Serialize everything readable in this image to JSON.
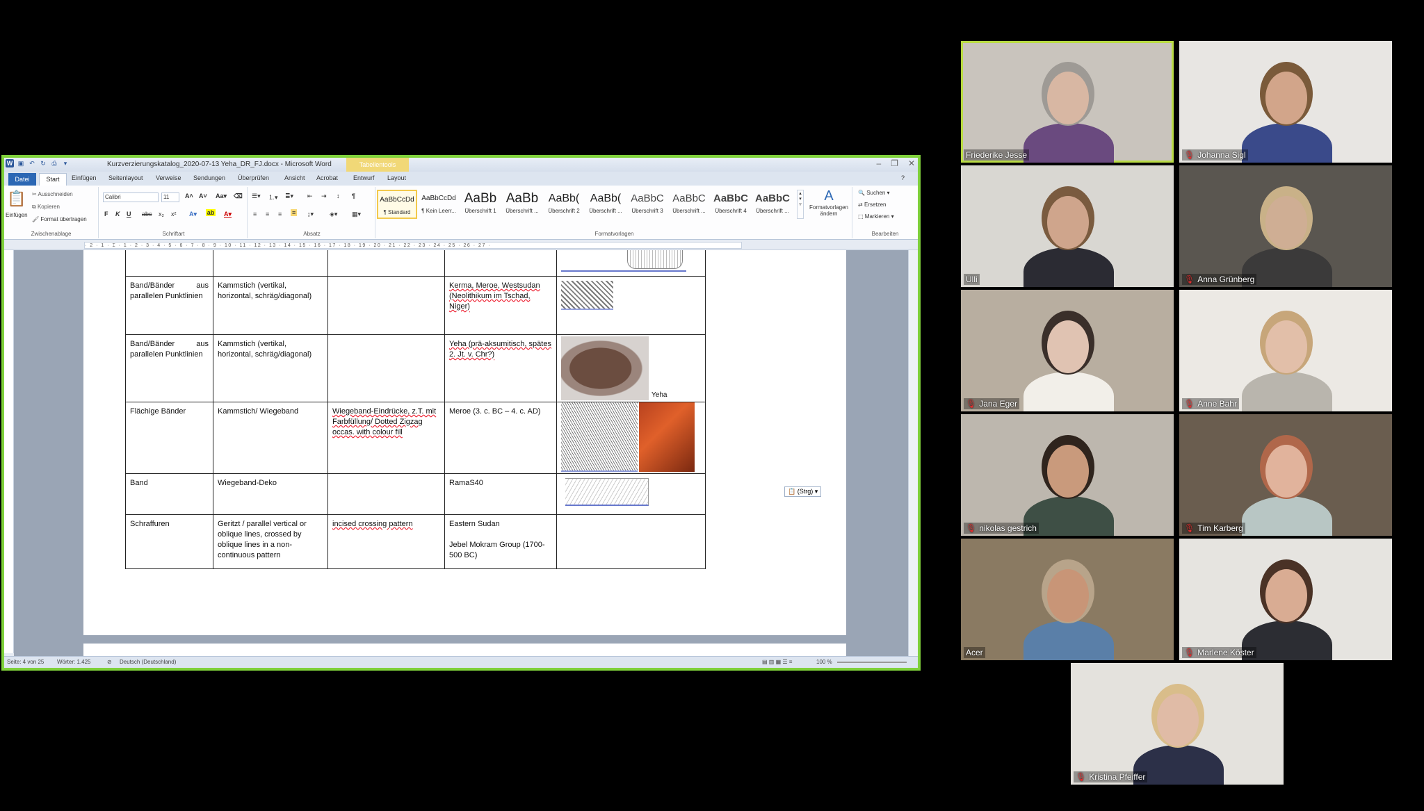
{
  "window": {
    "title": "Kurzverzierungskatalog_2020-07-13 Yeha_DR_FJ.docx - Microsoft Word",
    "context_tab": "Tabellentools",
    "controls": [
      "–",
      "❐",
      "✕"
    ]
  },
  "ribbon_tabs": [
    "Datei",
    "Start",
    "Einfügen",
    "Seitenlayout",
    "Verweise",
    "Sendungen",
    "Überprüfen",
    "Ansicht",
    "Acrobat",
    "Entwurf",
    "Layout"
  ],
  "clipboard": {
    "paste": "Einfügen",
    "cut": "Ausschneiden",
    "copy": "Kopieren",
    "format_painter": "Format übertragen",
    "label": "Zwischenablage"
  },
  "font": {
    "name": "Calibri",
    "size": "11",
    "label": "Schriftart",
    "bold": "F",
    "italic": "K",
    "underline": "U",
    "strike": "abc",
    "sub": "x₂",
    "sup": "x²"
  },
  "paragraph": {
    "label": "Absatz"
  },
  "styles": {
    "label": "Formatvorlagen",
    "items": [
      {
        "preview": "AaBbCcDd",
        "name": "¶ Standard"
      },
      {
        "preview": "AaBbCcDd",
        "name": "¶ Kein Leerr..."
      },
      {
        "preview": "AaBb",
        "name": "Überschrift 1"
      },
      {
        "preview": "AaBb",
        "name": "Überschrift ..."
      },
      {
        "preview": "AaBb(",
        "name": "Überschrift 2"
      },
      {
        "preview": "AaBb(",
        "name": "Überschrift ..."
      },
      {
        "preview": "AaBbC",
        "name": "Überschrift 3"
      },
      {
        "preview": "AaBbC",
        "name": "Überschrift ..."
      },
      {
        "preview": "AaBbC",
        "name": "Überschrift 4"
      },
      {
        "preview": "AaBbC",
        "name": "Überschrift ..."
      }
    ],
    "change": "Formatvorlagen ändern"
  },
  "editing": {
    "find": "Suchen",
    "replace": "Ersetzen",
    "select": "Markieren",
    "label": "Bearbeiten"
  },
  "ruler_text": "· 2 · 1 · ⌶ · 1 · 2 · 3 · 4 · 5 · 6 · 7 · 8 · 9 · 10 · 11 · 12 · 13 · 14 · 15 · 16 · 17 · 18 · 19 · 20 · 21 · 22 · 23 · 24 · 25 · 26 · 27 ·",
  "table": {
    "rows": [
      {
        "c1": "",
        "c2": "",
        "c3": "",
        "c4": "",
        "img": "partial"
      },
      {
        "c1": "Band/Bänder aus parallelen Punktlinien",
        "c2": "Kammstich (vertikal, horizontal, schräg/diagonal)",
        "c3": "",
        "c4": "Kerma, Meroe, Westsudan (Neolithikum im Tschad, Niger)",
        "img": "zigzag"
      },
      {
        "c1": "Band/Bänder aus parallelen Punktlinien",
        "c2": "Kammstich (vertikal, horizontal, schräg/diagonal)",
        "c3": "",
        "c4": "Yeha (prä-aksumitisch, spätes 2. Jt. v. Chr?)",
        "img": "sherd",
        "img_caption": "Yeha"
      },
      {
        "c1": "Flächige Bänder",
        "c2": "Kammstich/ Wiegeband",
        "c3": "Wiegeband-Eindrücke, z.T. mit Farbfüllung/ Dotted Zigzag occas. with colour fill",
        "c4": "Meroe (3. c. BC – 4. c. AD)",
        "img": "band"
      },
      {
        "c1": "Band",
        "c2": "Wiegeband-Deko",
        "c3": "",
        "c4": "RamaS40",
        "img": "sketch"
      },
      {
        "c1": "Schraffuren",
        "c2": "Geritzt / parallel vertical or oblique lines, crossed by oblique lines in a non-continuous pattern",
        "c3": "incised crossing pattern",
        "c4": "Eastern Sudan",
        "c4b": "Jebel Mokram Group (1700-500 BC)",
        "img": "none"
      }
    ]
  },
  "paste_options": "(Strg) ▾",
  "status": {
    "page": "Seite: 4 von 25",
    "words": "Wörter: 1.425",
    "lang": "Deutsch (Deutschland)",
    "zoom": "100 %"
  },
  "participants": [
    {
      "name": "Friederike Jesse",
      "muted": false,
      "active": true,
      "bg": "#c9c4bd",
      "skin": "#d8b7a3",
      "hair": "#9e9a95",
      "shirt": "#6a4a7f"
    },
    {
      "name": "Johanna Sigl",
      "muted": true,
      "active": false,
      "bg": "#e8e6e3",
      "skin": "#d2a58a",
      "hair": "#7a5a3a",
      "shirt": "#3a4a8a"
    },
    {
      "name": "Ulli",
      "muted": false,
      "active": false,
      "bg": "#d9d7d2",
      "skin": "#cfa58c",
      "hair": "#7a5b3f",
      "shirt": "#2b2b33"
    },
    {
      "name": "Anna Grünberg",
      "muted": true,
      "active": false,
      "bg": "#5a5650",
      "skin": "#cfae94",
      "hair": "#c9b188",
      "shirt": "#3b3a3a"
    },
    {
      "name": "Jana Eger",
      "muted": true,
      "active": false,
      "bg": "#b8aea0",
      "skin": "#e0c3b2",
      "hair": "#3a2f2a",
      "shirt": "#f2efe9"
    },
    {
      "name": "Anne Bahr",
      "muted": true,
      "active": false,
      "bg": "#ece9e4",
      "skin": "#e2bfa9",
      "hair": "#c7a67a",
      "shirt": "#b9b5ad"
    },
    {
      "name": "nikolas gestrich",
      "muted": true,
      "active": false,
      "bg": "#bdb7ae",
      "skin": "#c99a7c",
      "hair": "#2f241d",
      "shirt": "#3e4f45"
    },
    {
      "name": "Tim Karberg",
      "muted": true,
      "active": false,
      "bg": "#6a5d4f",
      "skin": "#e1b39c",
      "hair": "#b0674a",
      "shirt": "#b8c6c4"
    },
    {
      "name": "Acer",
      "muted": false,
      "active": false,
      "bg": "#8a7a62",
      "skin": "#c89577",
      "hair": "#b8a48a",
      "shirt": "#5a7fa8"
    },
    {
      "name": "Marlene Köster",
      "muted": true,
      "active": false,
      "bg": "#e6e4e0",
      "skin": "#d9ac93",
      "hair": "#4a3226",
      "shirt": "#2c2d33"
    },
    {
      "name": "Kristina Pfeiffer",
      "muted": true,
      "active": false,
      "bg": "#e4e2dd",
      "skin": "#e0bba6",
      "hair": "#d9bd8a",
      "shirt": "#2c3048"
    }
  ]
}
